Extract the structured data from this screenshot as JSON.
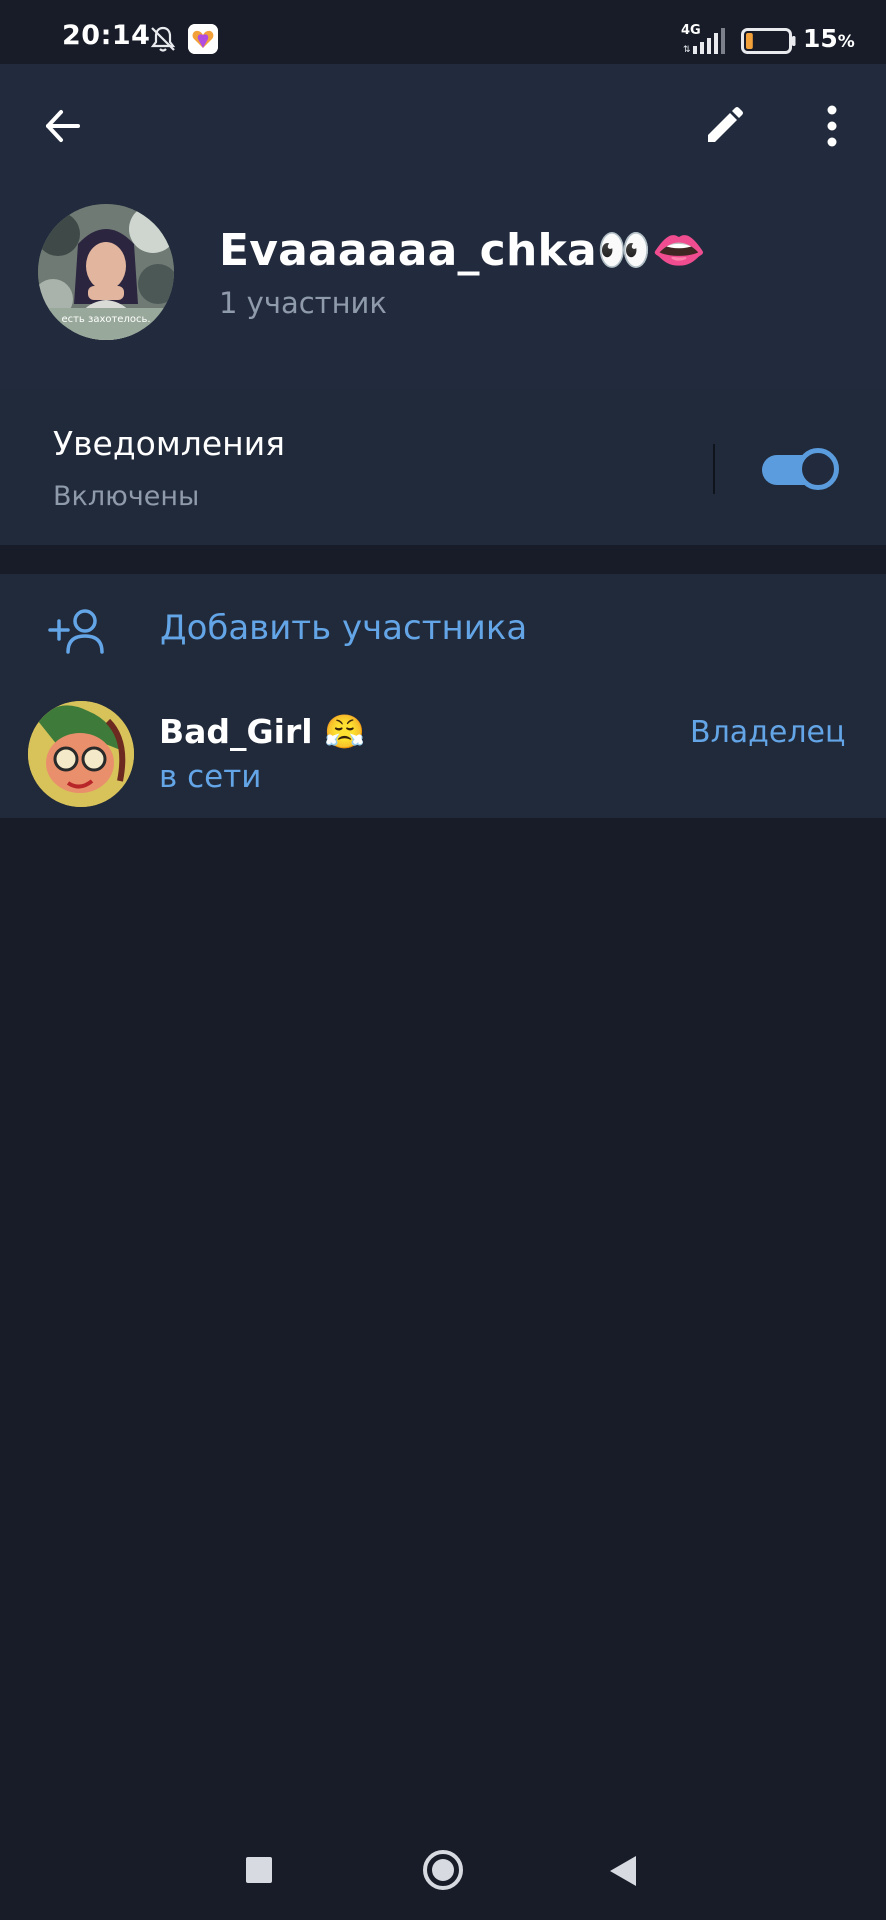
{
  "status_bar": {
    "time": "20:14",
    "network_type": "4G",
    "battery_percent": "15",
    "battery_unit": "%",
    "battery_level": 0.15,
    "icons": [
      "bell-off-icon",
      "app-badge-icon",
      "signal-icon",
      "battery-icon"
    ]
  },
  "header": {
    "group_name": "Evaaaaaa_chka👀👄",
    "members_count": "1 участник",
    "actions": [
      "back-arrow-icon",
      "pencil-icon",
      "more-vertical-icon"
    ]
  },
  "notifications": {
    "title": "Уведомления",
    "status": "Включены",
    "enabled": true,
    "accent_color": "#5a9cdd"
  },
  "members": {
    "add_label": "Добавить участника",
    "list": [
      {
        "name": "Bad_Girl 😤",
        "status": "в сети",
        "role": "Владелец"
      }
    ]
  },
  "colors": {
    "background": "#171c28",
    "header": "#222b3d",
    "accent": "#63a5e6",
    "secondary_text": "#8f9aab"
  }
}
